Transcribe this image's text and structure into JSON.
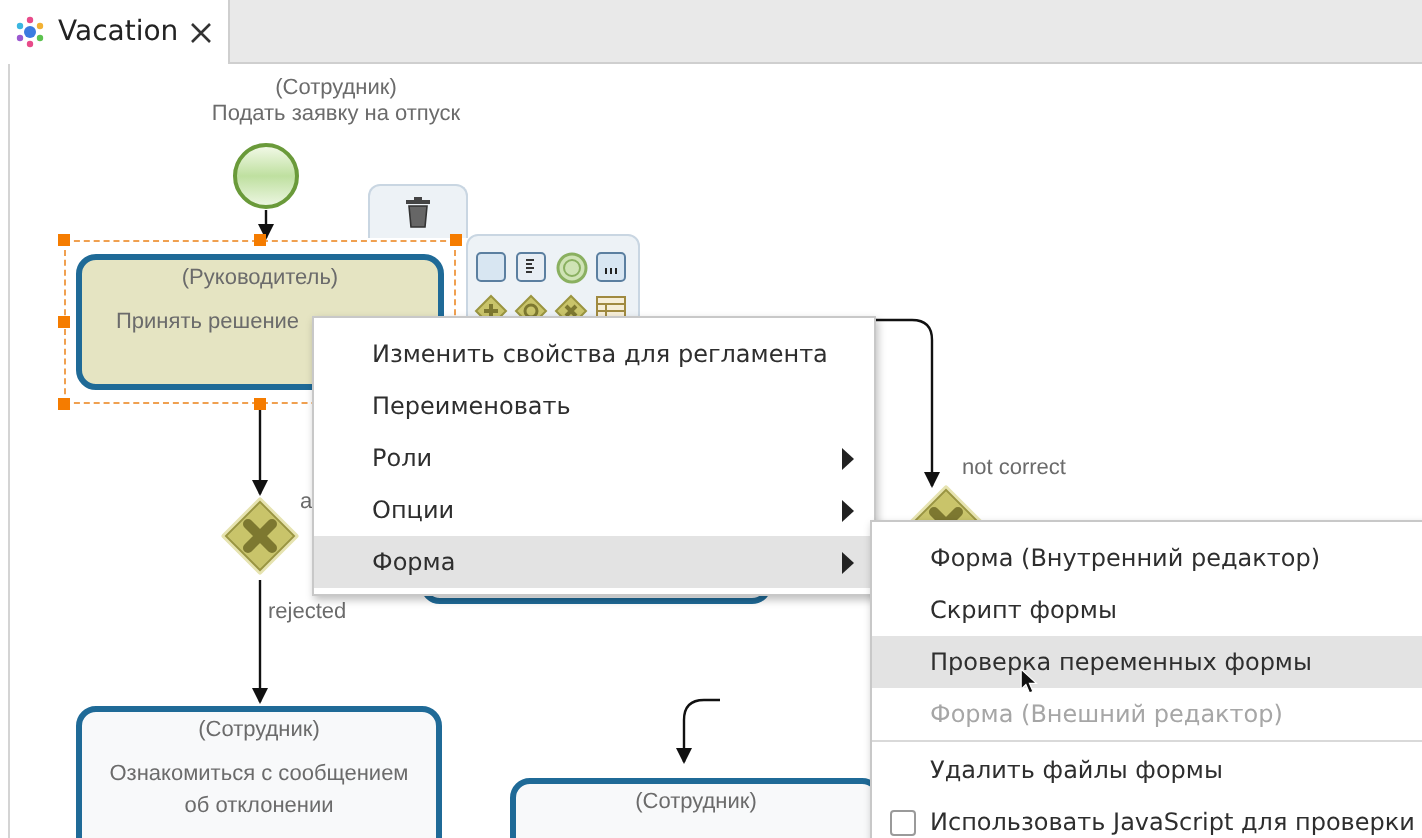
{
  "tabs": [
    {
      "title": "Vacation",
      "selected": true
    }
  ],
  "diagram": {
    "nodes": [
      {
        "kind": "start",
        "lane": "(Сотрудник)",
        "name": "Подать заявку на отпуск"
      },
      {
        "kind": "task",
        "lane": "(Руководитель)",
        "name": "Принять решение",
        "selected": true
      },
      {
        "kind": "gateway"
      },
      {
        "kind": "task",
        "lane": "(Сотрудник)",
        "name": "Ознакомиться с сообщением об отклонении",
        "selected": false
      },
      {
        "kind": "task",
        "selected": false
      },
      {
        "kind": "gateway"
      },
      {
        "kind": "task",
        "lane": "(Сотрудник)",
        "selected": false
      }
    ],
    "edge_labels": [
      "a",
      "rejected",
      "not correct"
    ]
  },
  "menu": {
    "items": [
      {
        "label": "Изменить свойства для регламента",
        "submenu": false,
        "selected": false
      },
      {
        "label": "Переименовать",
        "submenu": false,
        "selected": false
      },
      {
        "label": "Роли",
        "submenu": true,
        "selected": false
      },
      {
        "label": "Опции",
        "submenu": true,
        "selected": false
      },
      {
        "label": "Форма",
        "submenu": true,
        "selected": true
      }
    ]
  },
  "submenu": {
    "items": [
      {
        "kind": "item",
        "label": "Форма (Внутренний редактор)",
        "disabled": false,
        "selected": false
      },
      {
        "kind": "item",
        "label": "Скрипт формы",
        "disabled": false,
        "selected": false
      },
      {
        "kind": "item",
        "label": "Проверка переменных формы",
        "disabled": false,
        "selected": true
      },
      {
        "kind": "item",
        "label": "Форма (Внешний редактор)",
        "disabled": true,
        "selected": false
      },
      {
        "kind": "separator"
      },
      {
        "kind": "item",
        "label": "Удалить файлы формы",
        "disabled": false,
        "selected": false
      },
      {
        "kind": "checkbox",
        "label": "Использовать JavaScript для проверки",
        "checked": false,
        "selected": false
      }
    ]
  }
}
